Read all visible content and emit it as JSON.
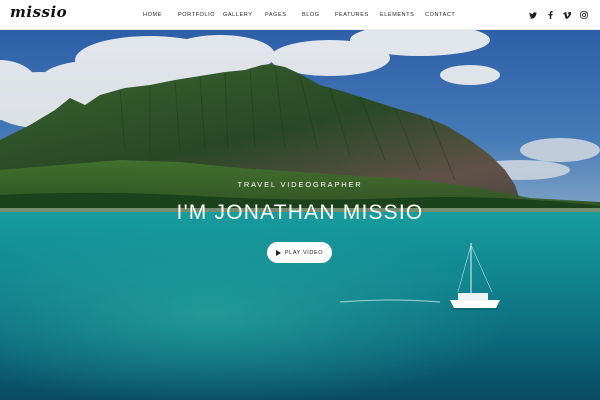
{
  "brand": {
    "logo": "missio"
  },
  "nav": {
    "items": [
      "HOME",
      "PORTFOLIO",
      "GALLERY",
      "PAGES",
      "BLOG",
      "FEATURES",
      "ELEMENTS",
      "CONTACT"
    ]
  },
  "social": {
    "icons": [
      "twitter-icon",
      "facebook-icon",
      "vimeo-icon",
      "instagram-icon"
    ]
  },
  "hero": {
    "tagline": "TRAVEL VIDEOGRAPHER",
    "title": "I'M JONATHAN MISSIO",
    "play_label": "PLAY VIDEO"
  },
  "colors": {
    "sky": "#3b6fb8",
    "mountain": "#2f5a2c",
    "sea": "#15a3a9",
    "deep_sea": "#0a4a66",
    "button_bg": "#ffffff",
    "text_light": "#ffffff"
  }
}
